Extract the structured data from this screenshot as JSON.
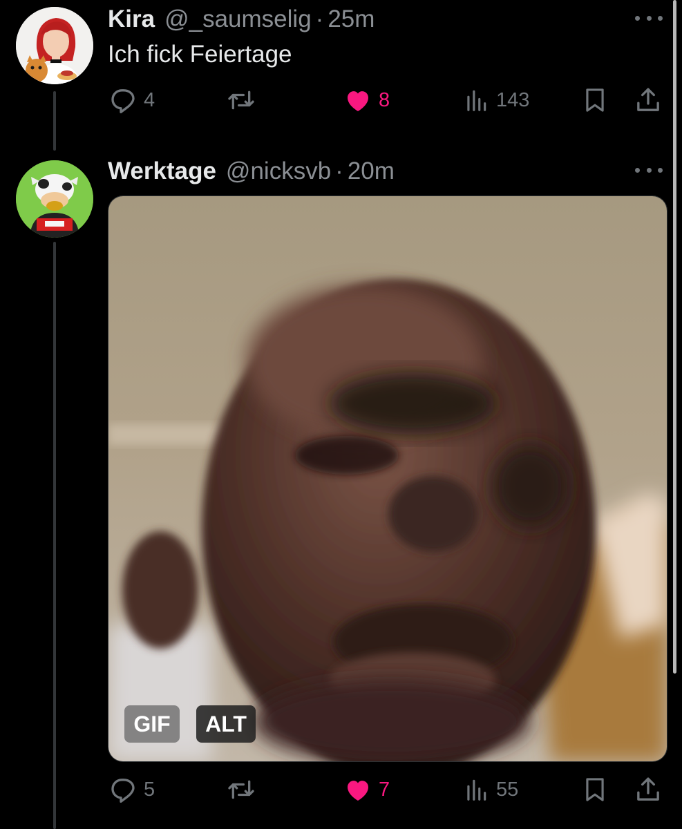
{
  "tweets": [
    {
      "name": "Kira",
      "handle": "@_saumselig",
      "separator": "·",
      "time": "25m",
      "text": "Ich fick Feiertage",
      "metrics": {
        "replies": "4",
        "likes": "8",
        "views": "143"
      }
    },
    {
      "name": "Werktage",
      "handle": "@nicksvb",
      "separator": "·",
      "time": "20m",
      "media": {
        "gif_label": "GIF",
        "alt_label": "ALT"
      },
      "metrics": {
        "replies": "5",
        "likes": "7",
        "views": "55"
      }
    }
  ],
  "colors": {
    "like": "#f91880",
    "muted": "#71767b",
    "text": "#e7e9ea",
    "background": "#000000"
  },
  "icons": [
    "reply-icon",
    "retweet-icon",
    "like-icon",
    "views-icon",
    "bookmark-icon",
    "share-icon",
    "more-icon"
  ]
}
